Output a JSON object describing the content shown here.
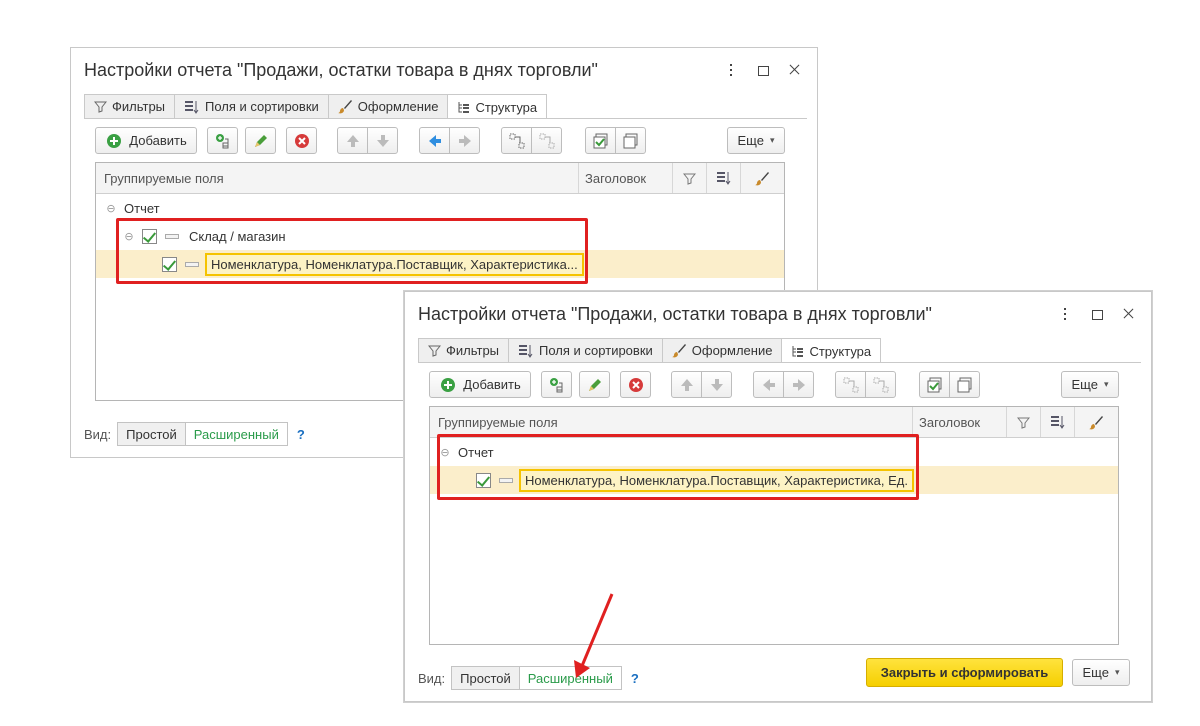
{
  "window": {
    "title": "Настройки отчета \"Продажи, остатки товара в днях торговли\""
  },
  "tabs": [
    {
      "label": "Фильтры",
      "icon": "filter-icon"
    },
    {
      "label": "Поля и сортировки",
      "icon": "fields-sort-icon"
    },
    {
      "label": "Оформление",
      "icon": "brush-icon"
    },
    {
      "label": "Структура",
      "icon": "structure-icon"
    }
  ],
  "active_tab": "Структура",
  "toolbar": {
    "add_label": "Добавить",
    "more_label": "Еще"
  },
  "grid": {
    "columns": [
      "Группируемые поля",
      "Заголовок"
    ],
    "column_icons": [
      "filter-icon",
      "fields-sort-icon",
      "brush-icon"
    ]
  },
  "back_window": {
    "rows": [
      {
        "level": 0,
        "label": "Отчет",
        "checked": false
      },
      {
        "level": 1,
        "label": "Склад / магазин",
        "checked": true
      },
      {
        "level": 2,
        "label": "Номенклатура, Номенклатура.Поставщик, Характеристика...",
        "checked": true,
        "selected": true
      }
    ]
  },
  "front_window": {
    "rows": [
      {
        "level": 0,
        "label": "Отчет",
        "checked": false
      },
      {
        "level": 1,
        "label": "Номенклатура, Номенклатура.Поставщик, Характеристика, Ед.",
        "checked": true,
        "selected": true
      }
    ],
    "close_button_label": "Закрыть и сформировать"
  },
  "mode": {
    "label": "Вид:",
    "options": [
      "Простой",
      "Расширенный"
    ],
    "selected": "Расширенный",
    "help": "?"
  },
  "colors": {
    "accent_green": "#2a9b4a",
    "highlight_red": "#e02020",
    "selection_yellow": "#fbeecb",
    "primary_yellow": "#f5cf00"
  }
}
